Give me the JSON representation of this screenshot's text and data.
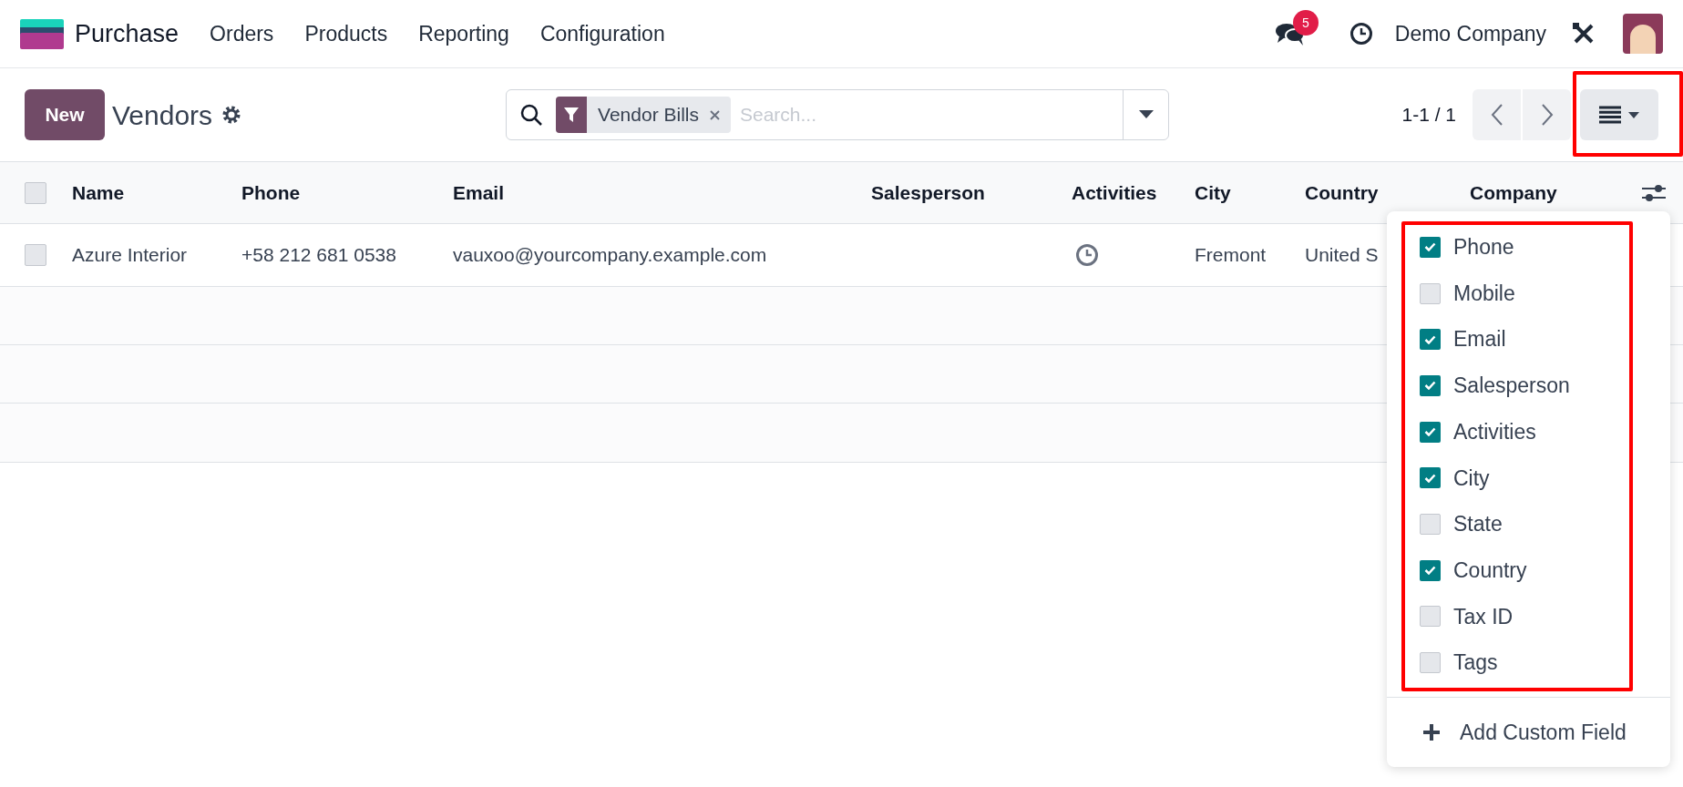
{
  "app": {
    "name": "Purchase",
    "menu": [
      "Orders",
      "Products",
      "Reporting",
      "Configuration"
    ]
  },
  "systray": {
    "messages_count": "5",
    "company": "Demo Company"
  },
  "control_panel": {
    "new_button": "New",
    "breadcrumb": "Vendors",
    "search": {
      "facets": [
        {
          "label": "Vendor Bills"
        }
      ],
      "placeholder": "Search..."
    },
    "pager": "1-1 / 1"
  },
  "table": {
    "select_all_checked": false,
    "columns": [
      "Name",
      "Phone",
      "Email",
      "Salesperson",
      "Activities",
      "City",
      "Country",
      "Company"
    ],
    "rows": [
      {
        "checked": false,
        "name": "Azure Interior",
        "phone": "+58 212 681 0538",
        "email": "vauxoo@yourcompany.example.com",
        "city": "Fremont",
        "country": "United S"
      }
    ]
  },
  "column_menu": {
    "fields": [
      {
        "label": "Phone",
        "checked": true
      },
      {
        "label": "Mobile",
        "checked": false
      },
      {
        "label": "Email",
        "checked": true
      },
      {
        "label": "Salesperson",
        "checked": true
      },
      {
        "label": "Activities",
        "checked": true
      },
      {
        "label": "City",
        "checked": true
      },
      {
        "label": "State",
        "checked": false
      },
      {
        "label": "Country",
        "checked": true
      },
      {
        "label": "Tax ID",
        "checked": false
      },
      {
        "label": "Tags",
        "checked": false
      }
    ],
    "add_custom_field": "Add Custom Field"
  }
}
